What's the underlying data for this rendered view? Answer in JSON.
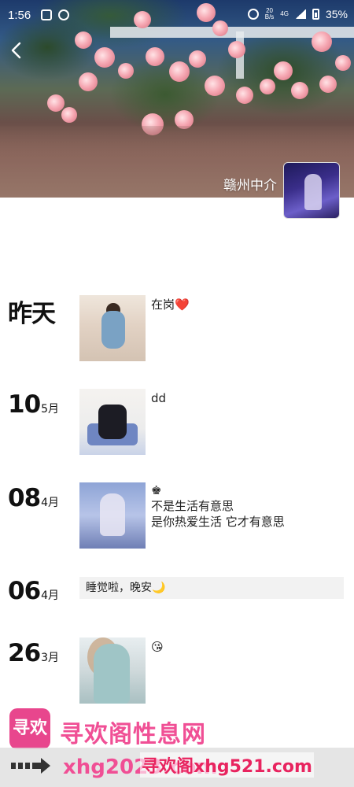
{
  "status_bar": {
    "time": "1:56",
    "net_speed_top": "20",
    "net_speed_bottom": "B/s",
    "network": "4G",
    "battery": "35%"
  },
  "profile": {
    "name": "赣州中介"
  },
  "timeline": [
    {
      "day": "昨天",
      "month": "",
      "caption": "在岗❤️"
    },
    {
      "day": "10",
      "month": "5月",
      "caption": "dd"
    },
    {
      "day": "08",
      "month": "4月",
      "caption_line1": "♚",
      "caption_line2": "不是生活有意思",
      "caption_line3": "是你热爱生活 它才有意思"
    },
    {
      "day": "06",
      "month": "4月",
      "text": "睡觉啦，晚安🌙"
    },
    {
      "day": "26",
      "month": "3月",
      "caption": "😘"
    }
  ],
  "watermark": {
    "logo_text": "寻欢",
    "title": "寻欢阁性息网",
    "url": "xhg2023.com",
    "url_overlay": "寻欢阁xhg521.com"
  }
}
